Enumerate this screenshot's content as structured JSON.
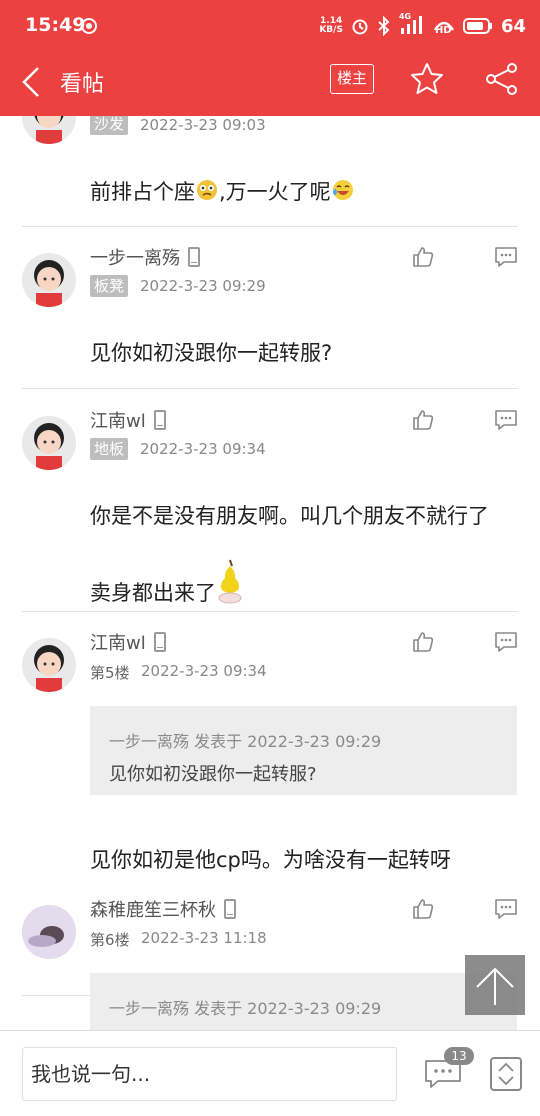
{
  "status_bar": {
    "time": "15:49",
    "net_speed_value": "1.14",
    "net_speed_unit": "KB/S",
    "signal_label": "4G",
    "hd_label": "HD",
    "battery": "64"
  },
  "nav": {
    "title": "看帖",
    "owner_button": "楼主"
  },
  "posts": [
    {
      "floor": "沙发",
      "time": "2022-3-23 09:03",
      "content": "前排占个座",
      "content_tail": ",万一火了呢"
    },
    {
      "user": "一步一离殇",
      "floor": "板凳",
      "time": "2022-3-23 09:29",
      "content": "见你如初没跟你一起转服?"
    },
    {
      "user": "江南wl",
      "floor": "地板",
      "time": "2022-3-23 09:34",
      "content_line1": "你是不是没有朋友啊。叫几个朋友不就行了",
      "content_line2": "卖身都出来了"
    },
    {
      "user": "江南wl",
      "floor": "第5楼",
      "time": "2022-3-23 09:34",
      "quote_head": "一步一离殇 发表于 2022-3-23 09:29",
      "quote_text": "见你如初没跟你一起转服?",
      "content": "见你如初是他cp吗。为啥没有一起转呀"
    },
    {
      "user": "森稚鹿笙三杯秋",
      "floor": "第6楼",
      "time": "2022-3-23 11:18",
      "quote_head": "一步一离殇 发表于 2022-3-23 09:29"
    }
  ],
  "bottom": {
    "reply_placeholder": "我也说一句...",
    "reply_count": "13"
  },
  "colors": {
    "brand": "#eb4141"
  }
}
